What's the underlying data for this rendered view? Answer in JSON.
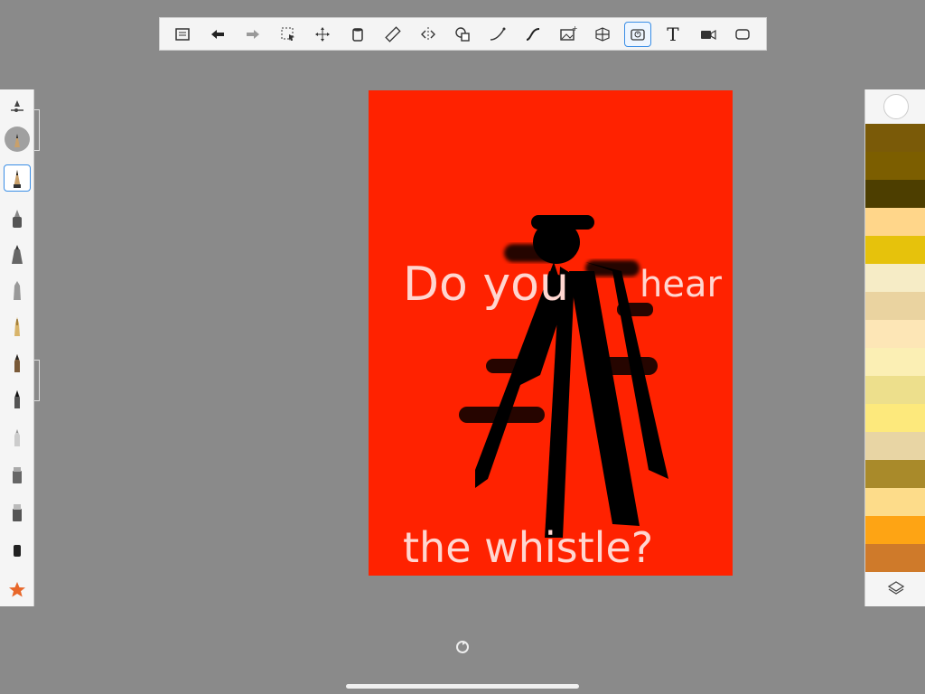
{
  "toolbar": {
    "items": [
      {
        "name": "gallery-icon"
      },
      {
        "name": "undo-icon"
      },
      {
        "name": "redo-icon"
      },
      {
        "name": "selection-icon"
      },
      {
        "name": "transform-icon"
      },
      {
        "name": "bucket-fill-icon"
      },
      {
        "name": "ruler-icon"
      },
      {
        "name": "symmetry-icon"
      },
      {
        "name": "shapes-icon"
      },
      {
        "name": "curve-icon"
      },
      {
        "name": "stroke-icon"
      },
      {
        "name": "add-image-icon"
      },
      {
        "name": "perspective-grid-icon"
      },
      {
        "name": "time-lapse-icon"
      },
      {
        "name": "text-icon",
        "label": "T"
      },
      {
        "name": "video-record-icon"
      },
      {
        "name": "fullscreen-icon"
      }
    ],
    "active": "time-lapse-icon"
  },
  "brushes": [
    "brush-settings-icon",
    "brush-preview-icon",
    "pencil-brush-icon",
    "ink-pen-icon",
    "marker-icon",
    "chisel-icon",
    "fountain-pen-icon",
    "paint-brush-icon",
    "round-brush-icon",
    "airbrush-icon",
    "smudge-icon",
    "eraser-icon",
    "fill-brush-icon",
    "favorites-star-icon"
  ],
  "active_brush": "pencil-brush-icon",
  "canvas": {
    "background": "#ff2200",
    "text_top_left": "Do you",
    "text_top_right": "hear",
    "text_bottom": "the whistle?"
  },
  "colors": {
    "swatches": [
      "#7a5a08",
      "#7c5e00",
      "#4d3e00",
      "#ffd68a",
      "#e6c20c",
      "#f6ecc6",
      "#ead3a0",
      "#fde6b6",
      "#fbefb4",
      "#eddf8c",
      "#fde97c",
      "#e8d5a4",
      "#a98a2a",
      "#fddc8a",
      "#fea414",
      "#cf7a2a"
    ],
    "accent": "#3a8ee6"
  }
}
